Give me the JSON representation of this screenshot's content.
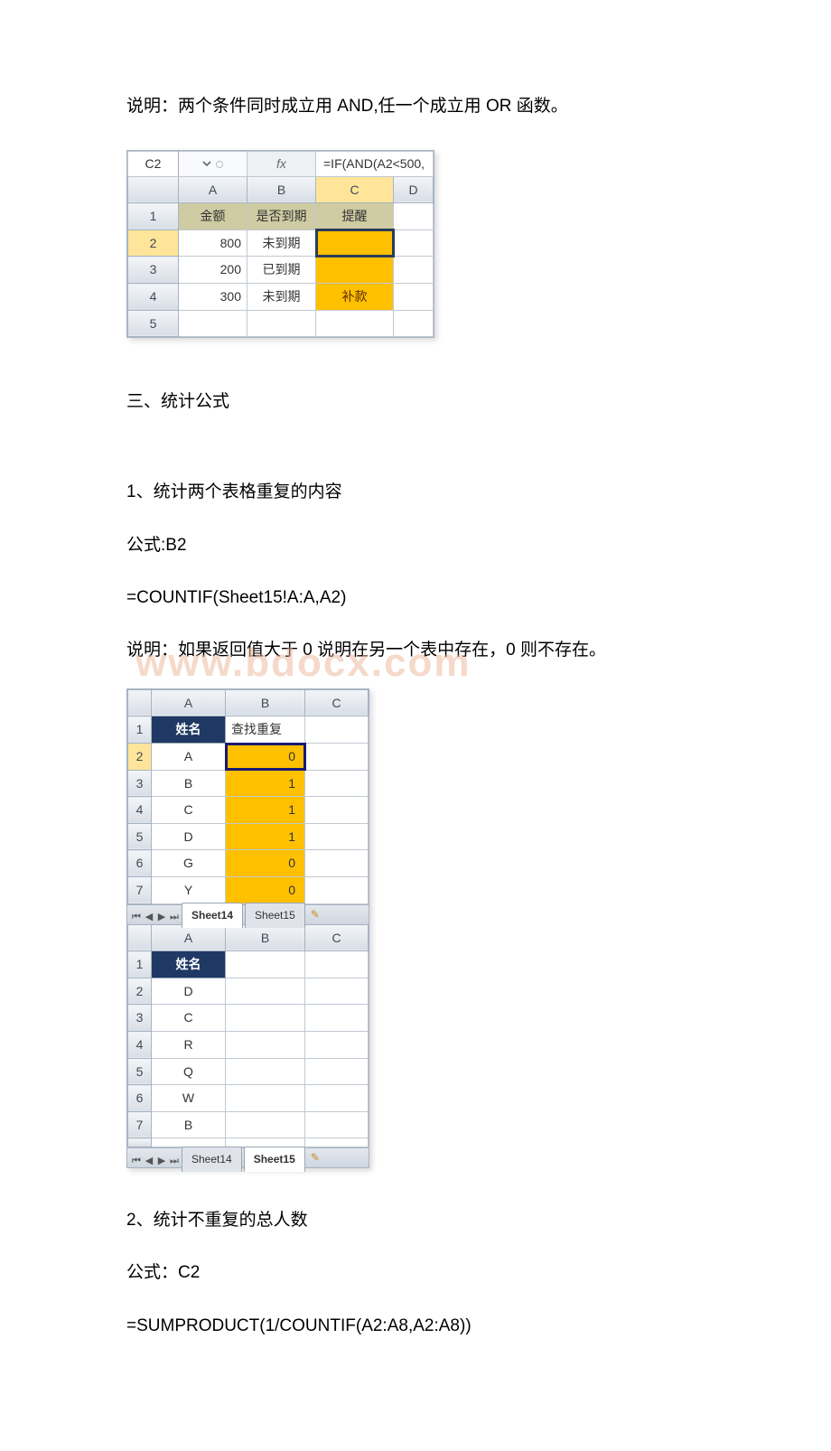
{
  "text": {
    "p1": "说明：两个条件同时成立用 AND,任一个成立用 OR 函数。",
    "section3": "三、统计公式",
    "s3_1": "1、统计两个表格重复的内容",
    "s3_1_gs": "公式:B2",
    "s3_1_formula": "=COUNTIF(Sheet15!A:A,A2)",
    "s3_1_note": "说明：如果返回值大于 0 说明在另一个表中存在，0 则不存在。",
    "s3_2": "2、统计不重复的总人数",
    "s3_2_gs": "公式：C2",
    "s3_2_formula": "=SUMPRODUCT(1/COUNTIF(A2:A8,A2:A8))"
  },
  "watermark": "www.bdocx.com",
  "img1": {
    "namebox": "C2",
    "fx_label": "fx",
    "formula": "=IF(AND(A2<500,",
    "cols": [
      "A",
      "B",
      "C",
      "D"
    ],
    "headers": [
      "金额",
      "是否到期",
      "提醒",
      ""
    ],
    "rows": [
      {
        "r": "1"
      },
      {
        "r": "2",
        "a": "800",
        "b": "未到期",
        "c": ""
      },
      {
        "r": "3",
        "a": "200",
        "b": "已到期",
        "c": ""
      },
      {
        "r": "4",
        "a": "300",
        "b": "未到期",
        "c": "补款"
      },
      {
        "r": "5"
      }
    ]
  },
  "img2": {
    "top": {
      "cols": [
        "A",
        "B",
        "C"
      ],
      "headers": [
        "姓名",
        "查找重复",
        ""
      ],
      "rows": [
        {
          "r": "1"
        },
        {
          "r": "2",
          "a": "A",
          "b": "0"
        },
        {
          "r": "3",
          "a": "B",
          "b": "1"
        },
        {
          "r": "4",
          "a": "C",
          "b": "1"
        },
        {
          "r": "5",
          "a": "D",
          "b": "1"
        },
        {
          "r": "6",
          "a": "G",
          "b": "0"
        },
        {
          "r": "7",
          "a": "Y",
          "b": "0"
        }
      ],
      "tabs": {
        "active": "Sheet14",
        "other": "Sheet15"
      }
    },
    "bottom": {
      "cols": [
        "A",
        "B",
        "C"
      ],
      "headers": [
        "姓名",
        "",
        ""
      ],
      "rows": [
        {
          "r": "1"
        },
        {
          "r": "2",
          "a": "D"
        },
        {
          "r": "3",
          "a": "C"
        },
        {
          "r": "4",
          "a": "R"
        },
        {
          "r": "5",
          "a": "Q"
        },
        {
          "r": "6",
          "a": "W"
        },
        {
          "r": "7",
          "a": "B"
        }
      ],
      "tabs": {
        "active": "Sheet15",
        "other": "Sheet14"
      }
    }
  }
}
